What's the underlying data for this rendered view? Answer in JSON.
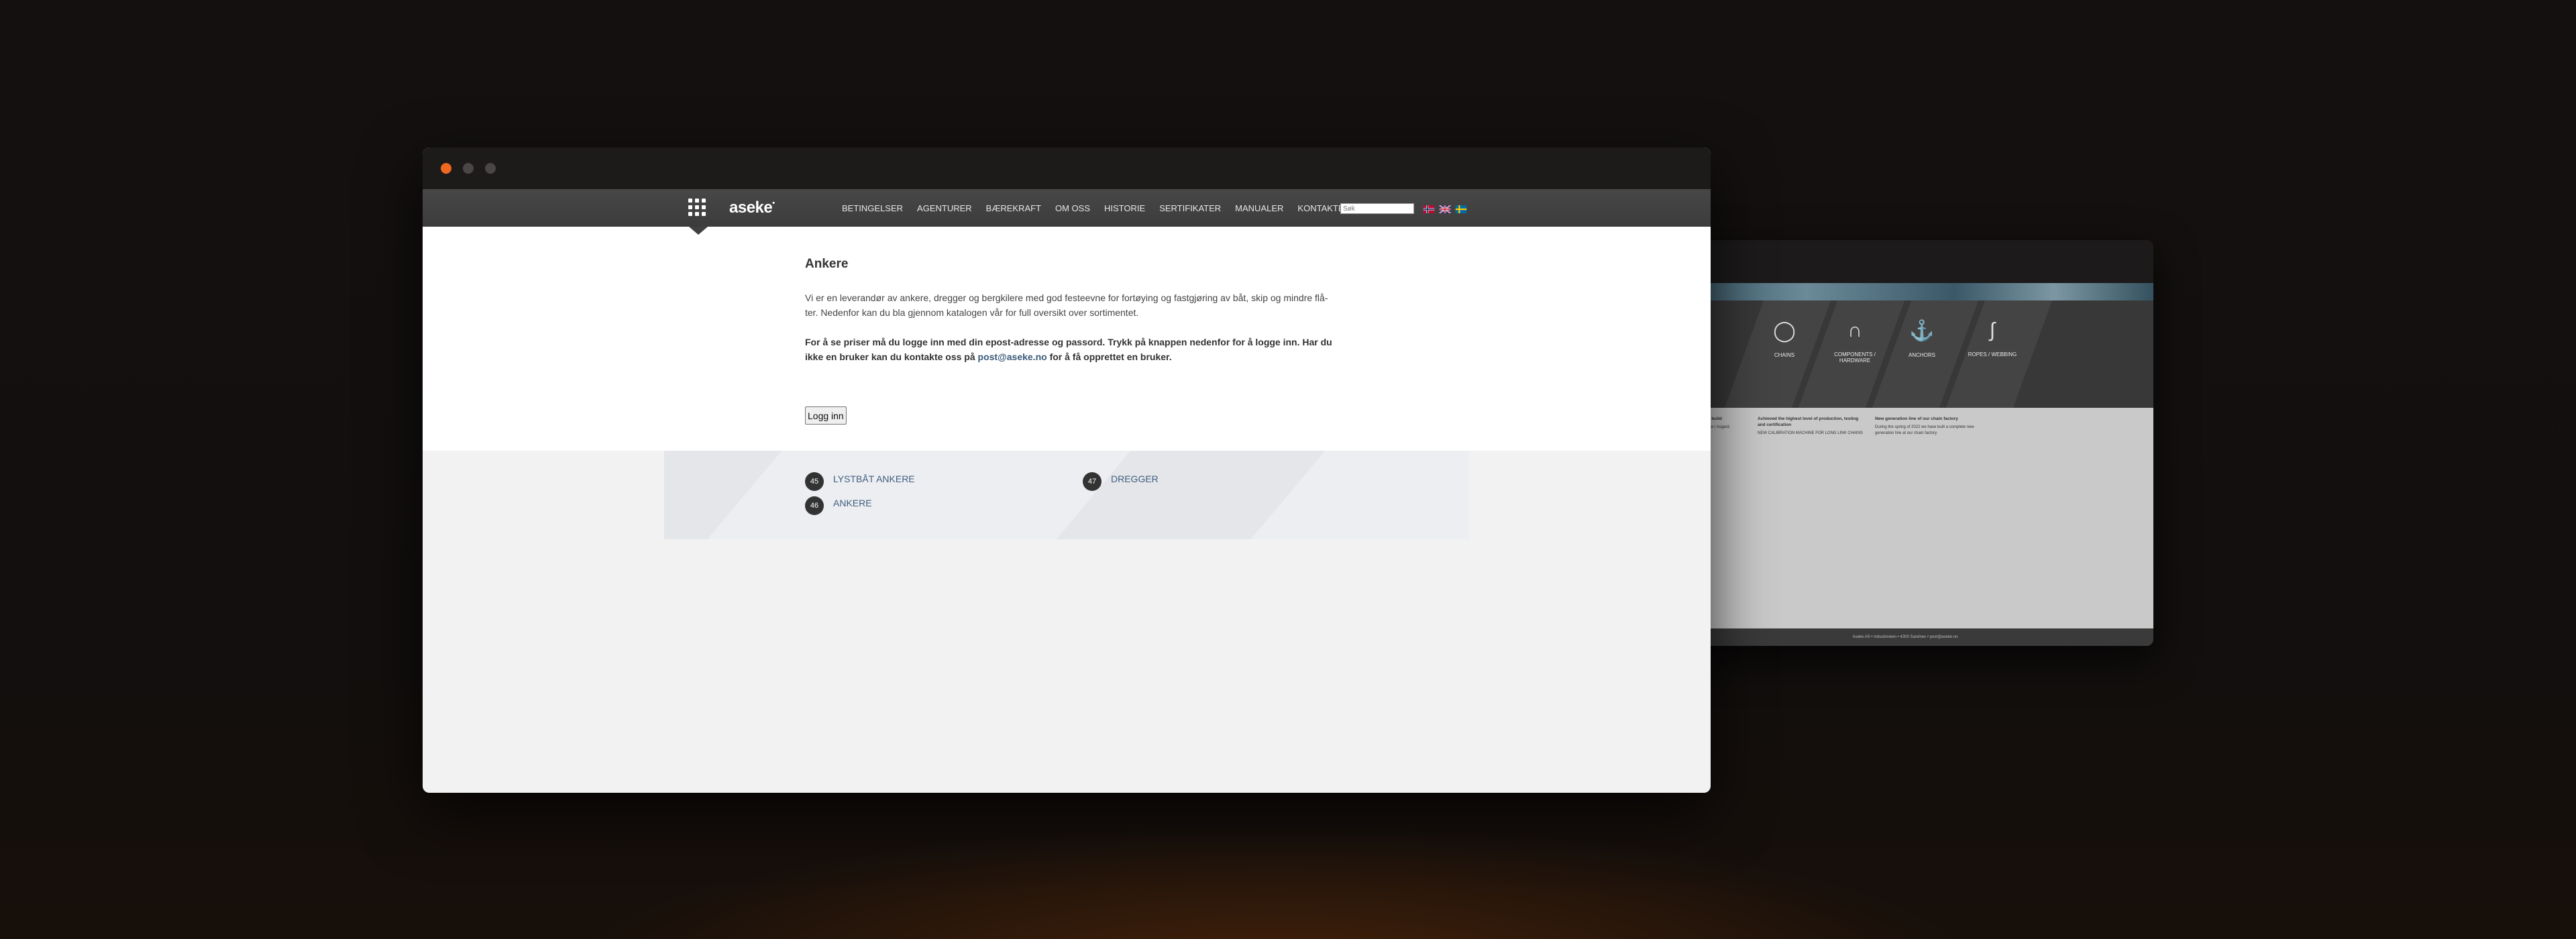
{
  "site": {
    "logo_text": "aseke",
    "logo_mark": "•",
    "menu": [
      "BETINGELSER",
      "AGENTURER",
      "BÆREKRAFT",
      "OM OSS",
      "HISTORIE",
      "SERTIFIKATER",
      "MANUALER",
      "KONTAKTER"
    ],
    "search_placeholder": "Søk",
    "flags": [
      "norway-flag",
      "uk-flag",
      "sweden-flag"
    ]
  },
  "page": {
    "title": "Ankere",
    "intro": "Vi er en leverandør av ankere, dregger og bergkilere med god festeevne for fortøying og fastgjøring av båt, skip og mindre flå­ter. Nedenfor kan du bla gjennom katalogen vår for full oversikt over sortimentet.",
    "login_text_before": "For å se priser må du logge inn med din epost-adresse og passord. Trykk på knappen nedenfor for å logge inn. Har du ikke en bruker kan du kontakte oss på ",
    "login_email": "post@aseke.no",
    "login_text_after": " for å få opprettet en bruker.",
    "login_button": "Logg inn"
  },
  "categories": [
    {
      "number": "45",
      "label": "LYSTBÅT ANKERE"
    },
    {
      "number": "47",
      "label": "DREGGER"
    },
    {
      "number": "46",
      "label": "ANKERE"
    }
  ],
  "background_window": {
    "categories": [
      "CHAINS",
      "COMPONENTS / HARDWARE",
      "ANCHORS",
      "ROPES / WEBBING"
    ],
    "columns": [
      {
        "heading": "Aseke offering channel build",
        "text": "Lorem text pr nyhet at Aseke i Asgard."
      },
      {
        "heading": "Achieved the highest level of production, testing and certification",
        "text": "NEW CALIBRATION MACHINE FOR LONG LINK CHAINS"
      },
      {
        "heading": "New generation line of our chain factory",
        "text": "During the spring of 2022 we have built a complete new generation line at our chain factory."
      }
    ],
    "footer": "Aseke AS • Industriveien • 4300 Sandnes • post@aseke.no"
  },
  "colors": {
    "nav_bg": "#404040",
    "close_dot": "#ef6820",
    "link": "#3f5d80",
    "badge": "#333333"
  }
}
